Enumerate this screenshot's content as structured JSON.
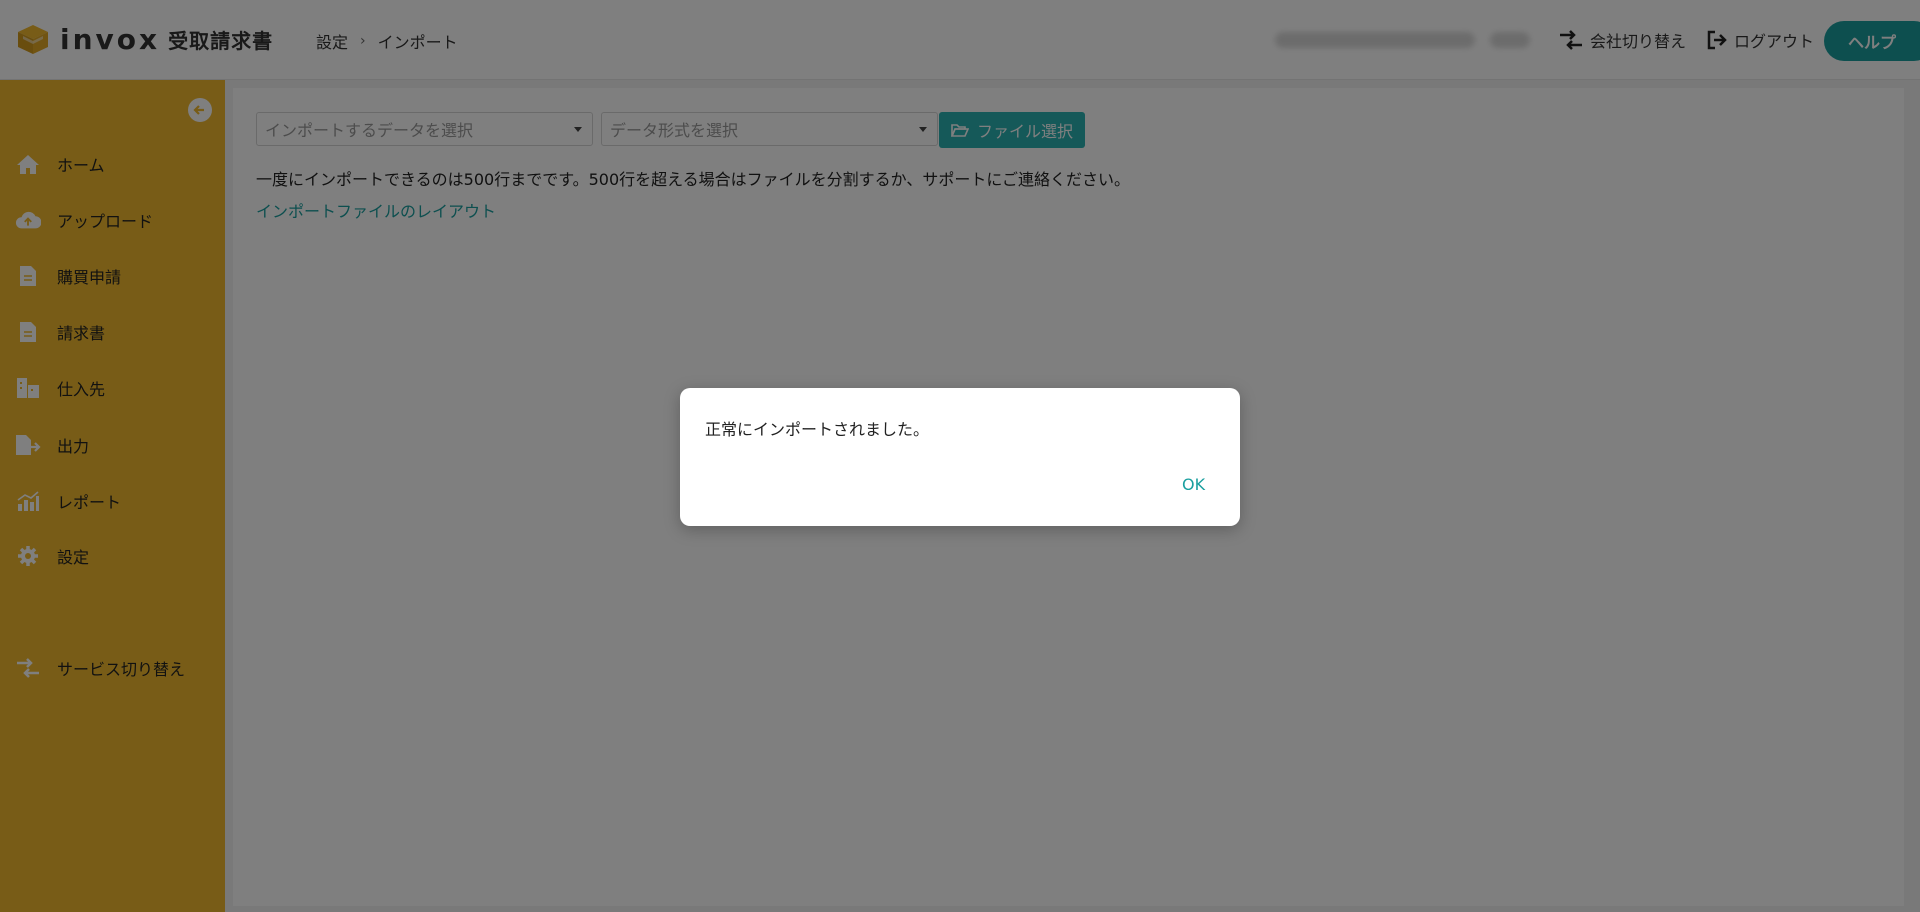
{
  "header": {
    "logo_text": "invox",
    "logo_subtitle": "受取請求書",
    "breadcrumb": [
      "設定",
      "インポート"
    ],
    "switch_company_label": "会社切り替え",
    "logout_label": "ログアウト",
    "help_label": "ヘルプ"
  },
  "sidebar": {
    "items": [
      {
        "label": "ホーム",
        "icon": "home-icon"
      },
      {
        "label": "アップロード",
        "icon": "cloud-upload-icon"
      },
      {
        "label": "購買申請",
        "icon": "document-icon"
      },
      {
        "label": "請求書",
        "icon": "document-icon"
      },
      {
        "label": "仕入先",
        "icon": "building-icon"
      },
      {
        "label": "出力",
        "icon": "file-export-icon"
      },
      {
        "label": "レポート",
        "icon": "bar-chart-icon"
      },
      {
        "label": "設定",
        "icon": "gear-icon"
      }
    ],
    "service_switch_label": "サービス切り替え"
  },
  "import": {
    "data_select_placeholder": "インポートするデータを選択",
    "format_select_placeholder": "データ形式を選択",
    "file_button_label": "ファイル選択",
    "notice": "一度にインポートできるのは500行までです。500行を超える場合はファイルを分割するか、サポートにご連絡ください。",
    "layout_link": "インポートファイルのレイアウト"
  },
  "dialog": {
    "message": "正常にインポートされました。",
    "ok_label": "OK"
  },
  "colors": {
    "sidebar": "#f0b92f",
    "accent": "#1a9f9f",
    "overlay": "rgba(0,0,0,0.5)"
  }
}
